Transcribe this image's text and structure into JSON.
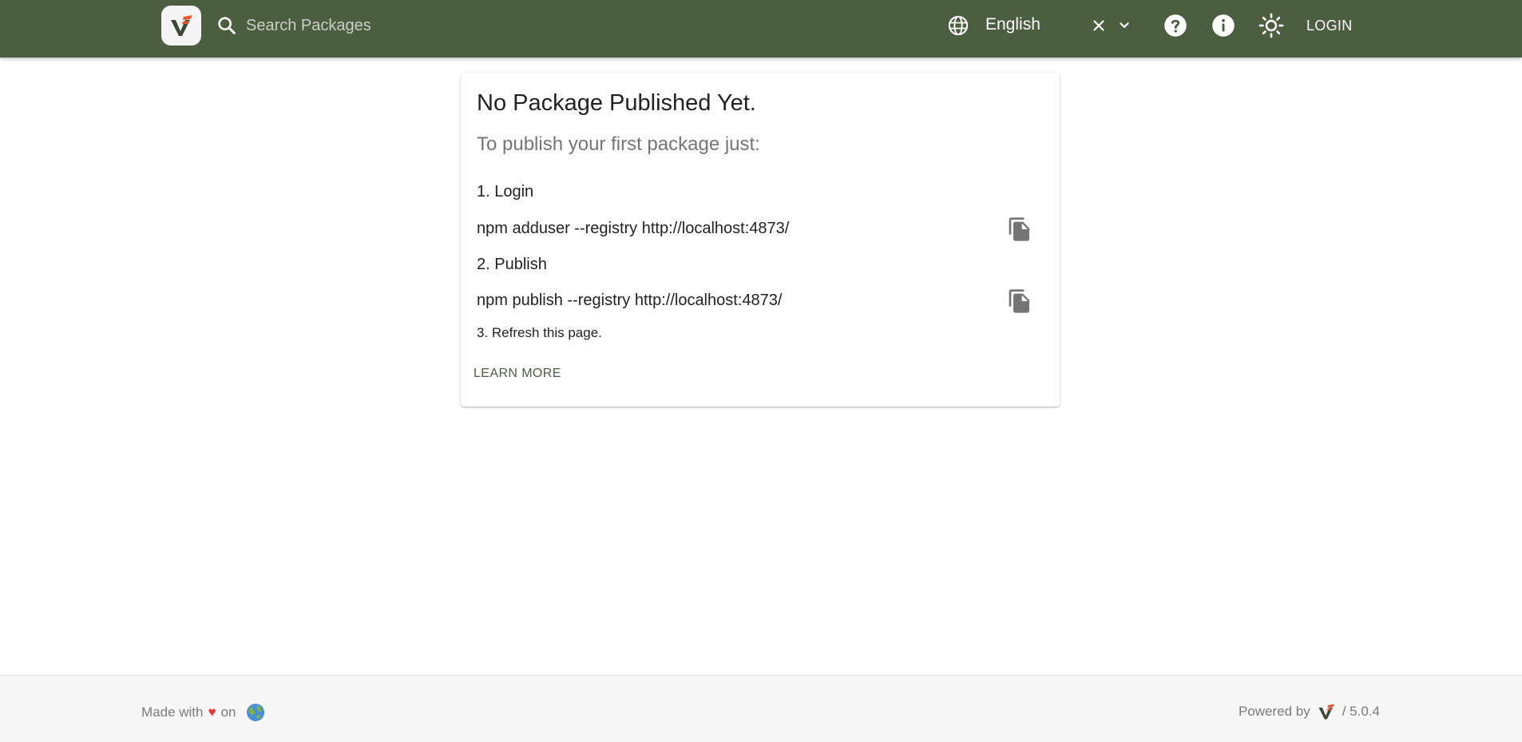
{
  "header": {
    "search_placeholder": "Search Packages",
    "language": "English",
    "login_label": "LOGIN",
    "icons": [
      "verdaccio-logo",
      "search-icon",
      "globe-icon",
      "clear-icon",
      "chevron-down-icon",
      "help-icon",
      "info-icon",
      "light-theme-icon"
    ]
  },
  "card": {
    "title": "No Package Published Yet.",
    "subtitle": "To publish your first package just:",
    "steps": [
      {
        "label": "1. Login",
        "command": "npm adduser --registry http://localhost:4873/"
      },
      {
        "label": "2. Publish",
        "command": "npm publish --registry http://localhost:4873/"
      },
      {
        "label": "3. Refresh this page."
      }
    ],
    "learn_more": "LEARN MORE"
  },
  "footer": {
    "made_with": "Made with",
    "heart": "♥",
    "on": "on",
    "powered_by": "Powered by",
    "version": "/ 5.0.4"
  },
  "colors": {
    "appbar": "#4b5e40",
    "accent_orange": "#e7522f",
    "text_muted": "#757575"
  }
}
